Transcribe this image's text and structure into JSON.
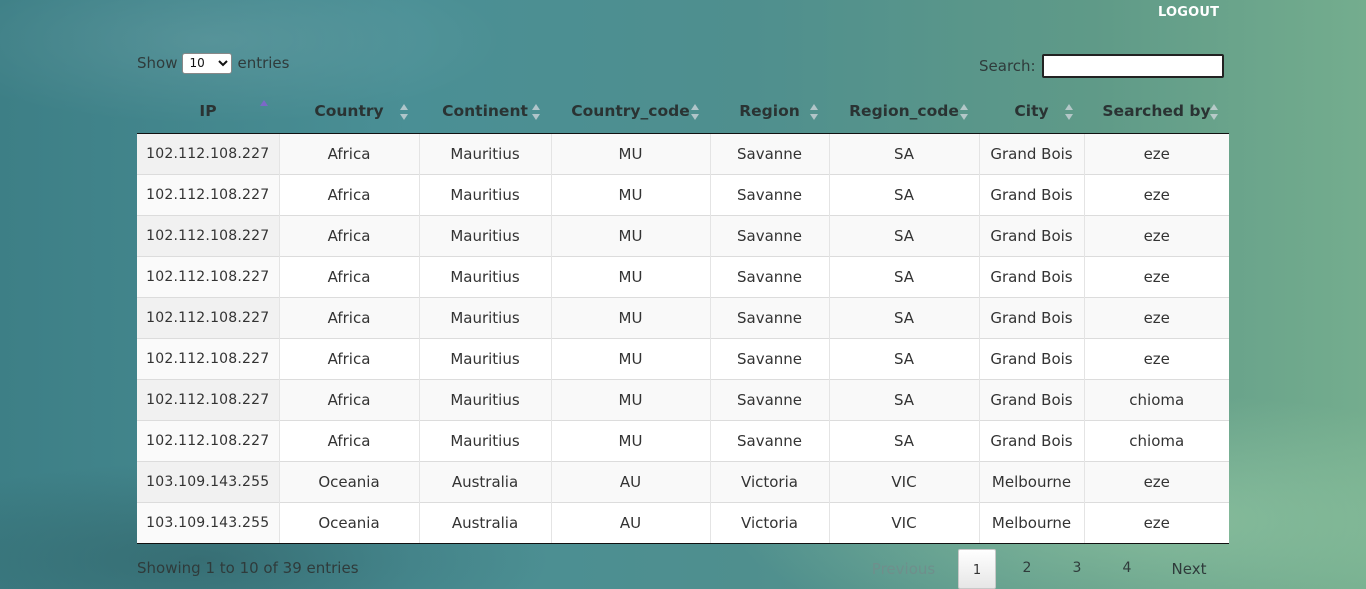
{
  "header": {
    "logout_label": "LOGOUT"
  },
  "length_control": {
    "show_label": "Show",
    "entries_label": "entries",
    "selected_value": "10"
  },
  "search": {
    "label": "Search:",
    "value": ""
  },
  "table": {
    "columns": [
      "IP",
      "Country",
      "Continent",
      "Country_code",
      "Region",
      "Region_code",
      "City",
      "Searched by"
    ],
    "sorted_column": "IP",
    "sort_direction": "asc",
    "rows": [
      [
        "102.112.108.227",
        "Africa",
        "Mauritius",
        "MU",
        "Savanne",
        "SA",
        "Grand Bois",
        "eze"
      ],
      [
        "102.112.108.227",
        "Africa",
        "Mauritius",
        "MU",
        "Savanne",
        "SA",
        "Grand Bois",
        "eze"
      ],
      [
        "102.112.108.227",
        "Africa",
        "Mauritius",
        "MU",
        "Savanne",
        "SA",
        "Grand Bois",
        "eze"
      ],
      [
        "102.112.108.227",
        "Africa",
        "Mauritius",
        "MU",
        "Savanne",
        "SA",
        "Grand Bois",
        "eze"
      ],
      [
        "102.112.108.227",
        "Africa",
        "Mauritius",
        "MU",
        "Savanne",
        "SA",
        "Grand Bois",
        "eze"
      ],
      [
        "102.112.108.227",
        "Africa",
        "Mauritius",
        "MU",
        "Savanne",
        "SA",
        "Grand Bois",
        "eze"
      ],
      [
        "102.112.108.227",
        "Africa",
        "Mauritius",
        "MU",
        "Savanne",
        "SA",
        "Grand Bois",
        "chioma"
      ],
      [
        "102.112.108.227",
        "Africa",
        "Mauritius",
        "MU",
        "Savanne",
        "SA",
        "Grand Bois",
        "chioma"
      ],
      [
        "103.109.143.255",
        "Oceania",
        "Australia",
        "AU",
        "Victoria",
        "VIC",
        "Melbourne",
        "eze"
      ],
      [
        "103.109.143.255",
        "Oceania",
        "Australia",
        "AU",
        "Victoria",
        "VIC",
        "Melbourne",
        "eze"
      ]
    ]
  },
  "footer": {
    "info": "Showing 1 to 10 of 39 entries",
    "previous_label": "Previous",
    "next_label": "Next",
    "pages": [
      "1",
      "2",
      "3",
      "4"
    ],
    "current_page": "1"
  }
}
